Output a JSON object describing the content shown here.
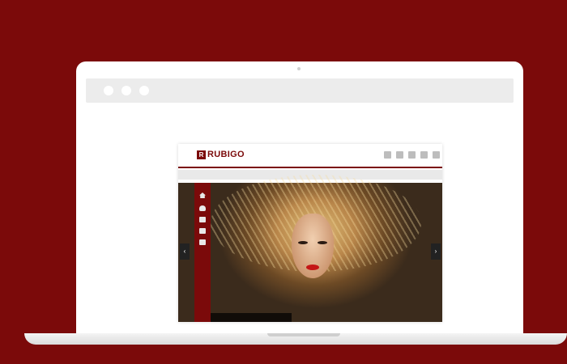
{
  "colors": {
    "background": "#7b0a0a",
    "brand": "#7b0a0a",
    "lid": "#ffffff",
    "browser_bar": "#ececec"
  },
  "site": {
    "logo_mark": "R",
    "logo_text": "RUBIGO",
    "social_icons": [
      "social-icon-1",
      "social-icon-2",
      "social-icon-3",
      "social-icon-4",
      "social-icon-5"
    ],
    "nav_icons": [
      "home-icon",
      "user-icon",
      "grid-icon",
      "chat-icon",
      "mail-icon"
    ],
    "slider": {
      "prev": "‹",
      "next": "›"
    },
    "caption": "",
    "credit": ""
  }
}
